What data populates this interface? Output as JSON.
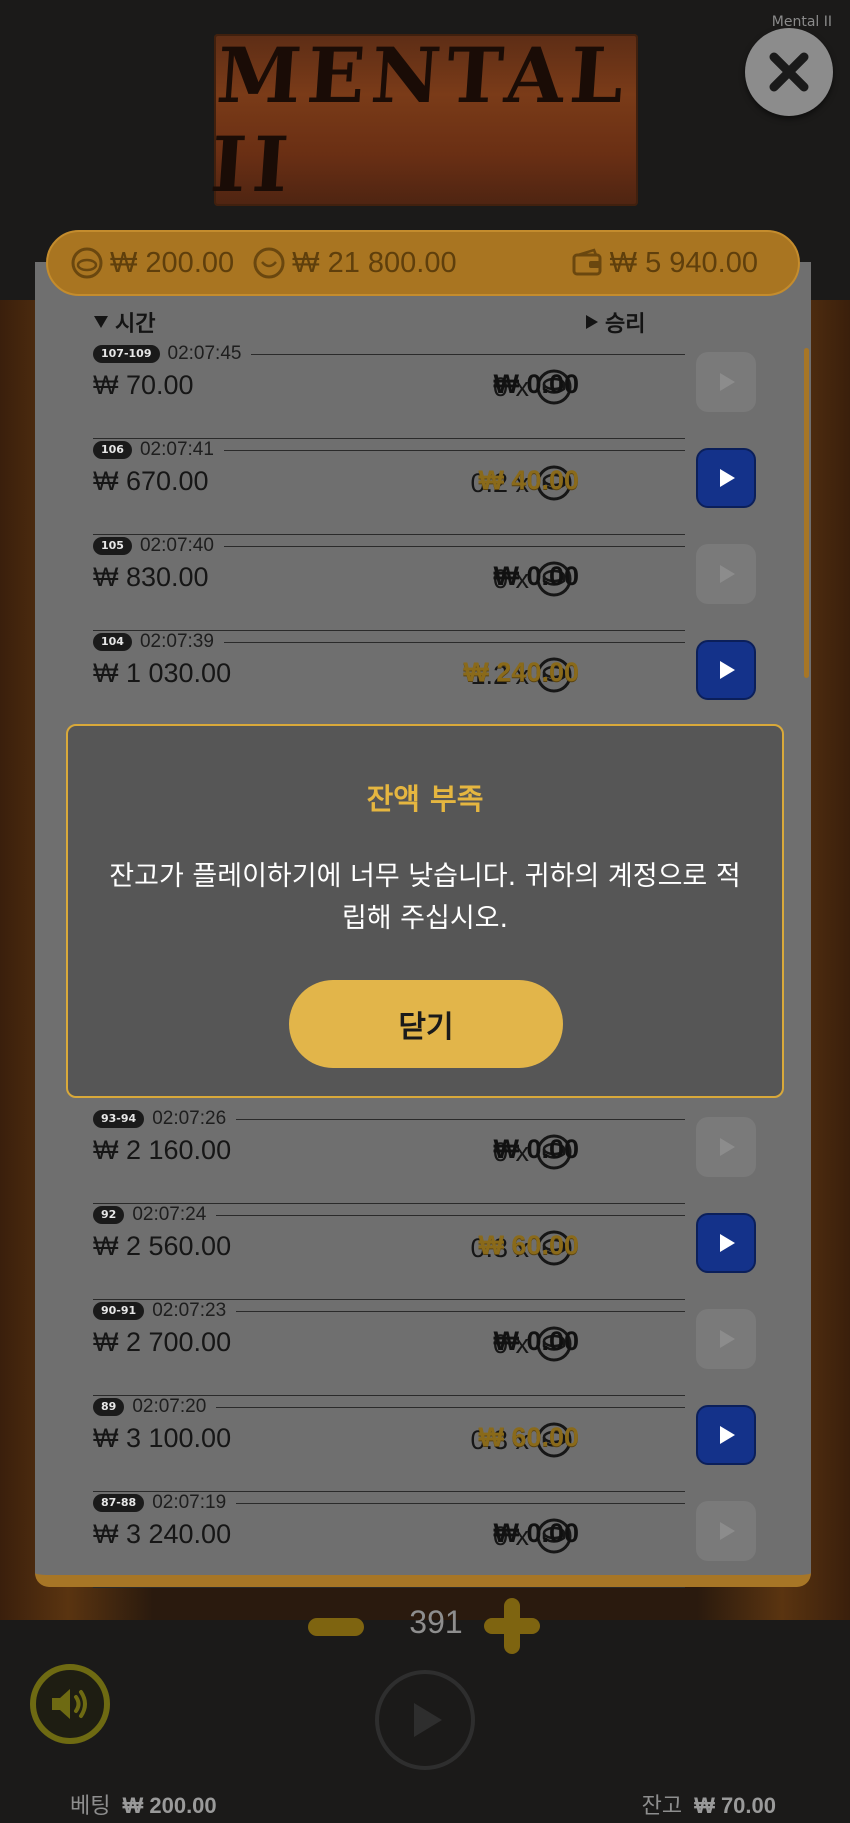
{
  "app_label": "Mental II",
  "logo_text": "MENTAL II",
  "summary": {
    "bet_total": "₩ 200.00",
    "win_total": "₩ 21 800.00",
    "wallet": "₩ 5 940.00"
  },
  "columns": {
    "time": "시간",
    "win": "승리"
  },
  "rows_top": [
    {
      "badge": "107-109",
      "time": "02:07:45",
      "bet": "₩ 70.00",
      "mult": "0 x",
      "win": "₩ 0.00",
      "positive": false
    },
    {
      "badge": "106",
      "time": "02:07:41",
      "bet": "₩ 670.00",
      "mult": "0.2 x",
      "win": "₩ 40.00",
      "positive": true
    },
    {
      "badge": "105",
      "time": "02:07:40",
      "bet": "₩ 830.00",
      "mult": "0 x",
      "win": "₩ 0.00",
      "positive": false
    },
    {
      "badge": "104",
      "time": "02:07:39",
      "bet": "₩ 1 030.00",
      "mult": "1.2 x",
      "win": "₩ 240.00",
      "positive": true
    }
  ],
  "rows_bottom": [
    {
      "badge": "93-94",
      "time": "02:07:26",
      "bet": "₩ 2 160.00",
      "mult": "0 x",
      "win": "₩ 0.00",
      "positive": false
    },
    {
      "badge": "92",
      "time": "02:07:24",
      "bet": "₩ 2 560.00",
      "mult": "0.3 x",
      "win": "₩ 60.00",
      "positive": true
    },
    {
      "badge": "90-91",
      "time": "02:07:23",
      "bet": "₩ 2 700.00",
      "mult": "0 x",
      "win": "₩ 0.00",
      "positive": false
    },
    {
      "badge": "89",
      "time": "02:07:20",
      "bet": "₩ 3 100.00",
      "mult": "0.3 x",
      "win": "₩ 60.00",
      "positive": true
    },
    {
      "badge": "87-88",
      "time": "02:07:19",
      "bet": "₩ 3 240.00",
      "mult": "0 x",
      "win": "₩ 0.00",
      "positive": false
    }
  ],
  "modal": {
    "title": "잔액 부족",
    "message": "잔고가 플레이하기에 너무 낮습니다. 귀하의 계정으로 적립해 주십시오.",
    "button": "닫기"
  },
  "stepper": {
    "value": "391"
  },
  "footer": {
    "bet_label": "베팅",
    "bet_value": "₩ 200.00",
    "balance_label": "잔고",
    "balance_value": "₩ 70.00"
  },
  "colors": {
    "accent": "#e2b54a",
    "play_active": "#14328a",
    "win_positive": "#8a6a1a"
  }
}
